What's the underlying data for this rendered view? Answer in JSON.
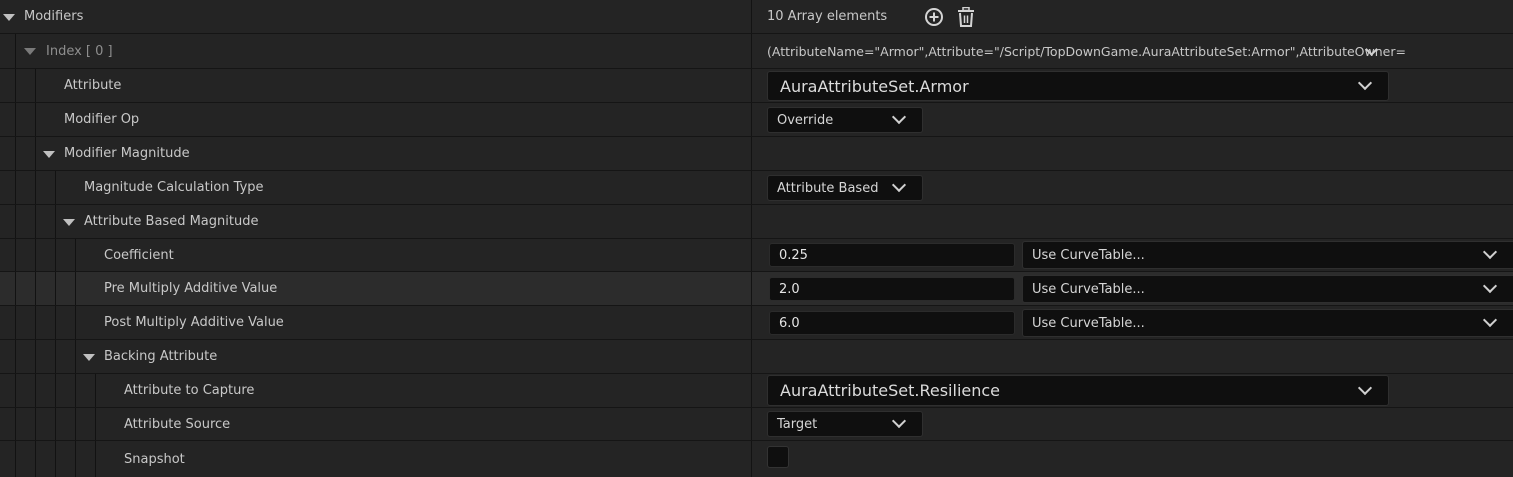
{
  "root": {
    "label": "Modifiers",
    "value": "10 Array elements",
    "add_icon": "add-circle-icon",
    "delete_icon": "trash-icon"
  },
  "index_row": {
    "label": "Index [ 0 ]",
    "value": "(AttributeName=\"Armor\",Attribute=\"/Script/TopDownGame.AuraAttributeSet:Armor\",AttributeOwner="
  },
  "attribute": {
    "label": "Attribute",
    "value": "AuraAttributeSet.Armor"
  },
  "modifier_op": {
    "label": "Modifier Op",
    "value": "Override"
  },
  "modifier_magnitude": {
    "label": "Modifier Magnitude"
  },
  "calc_type": {
    "label": "Magnitude Calculation Type",
    "value": "Attribute Based"
  },
  "attribute_based": {
    "label": "Attribute Based Magnitude"
  },
  "coefficient": {
    "label": "Coefficient",
    "value": "0.25",
    "curve": "Use CurveTable..."
  },
  "pre_multiply": {
    "label": "Pre Multiply Additive Value",
    "value": "2.0",
    "curve": "Use CurveTable..."
  },
  "post_multiply": {
    "label": "Post Multiply Additive Value",
    "value": "6.0",
    "curve": "Use CurveTable..."
  },
  "backing_attribute": {
    "label": "Backing Attribute"
  },
  "attribute_to_capture": {
    "label": "Attribute to Capture",
    "value": "AuraAttributeSet.Resilience"
  },
  "attribute_source": {
    "label": "Attribute Source",
    "value": "Target"
  },
  "snapshot": {
    "label": "Snapshot",
    "checked": false
  },
  "colors": {
    "row_bg": "#242424",
    "field_bg": "#0f0f0f",
    "highlight_row": "#2c2c2c"
  }
}
